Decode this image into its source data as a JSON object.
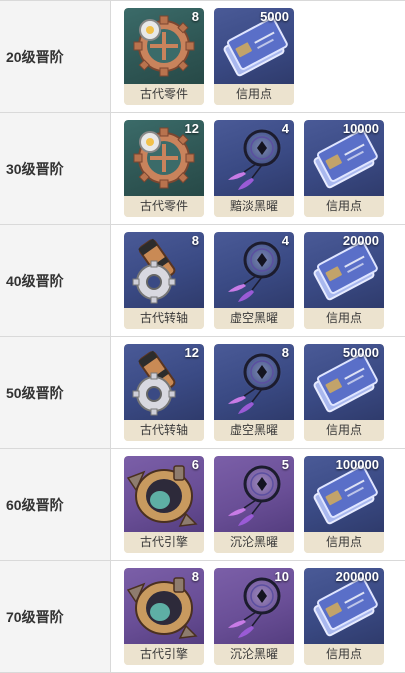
{
  "rows": [
    {
      "label": "20级晋阶",
      "items": [
        {
          "name": "古代零件",
          "count": "8",
          "icon": "gear-icon",
          "bg": "teal"
        },
        {
          "name": "信用点",
          "count": "5000",
          "icon": "credit-card-icon",
          "bg": "blue"
        }
      ]
    },
    {
      "label": "30级晋阶",
      "items": [
        {
          "name": "古代零件",
          "count": "12",
          "icon": "gear-icon",
          "bg": "teal"
        },
        {
          "name": "黯淡黑曜",
          "count": "4",
          "icon": "dreamcatcher-icon",
          "bg": "blue"
        },
        {
          "name": "信用点",
          "count": "10000",
          "icon": "credit-card-icon",
          "bg": "blue"
        }
      ]
    },
    {
      "label": "40级晋阶",
      "items": [
        {
          "name": "古代转轴",
          "count": "8",
          "icon": "spindle-icon",
          "bg": "blue"
        },
        {
          "name": "虚空黑曜",
          "count": "4",
          "icon": "dreamcatcher-icon",
          "bg": "blue"
        },
        {
          "name": "信用点",
          "count": "20000",
          "icon": "credit-card-icon",
          "bg": "blue"
        }
      ]
    },
    {
      "label": "50级晋阶",
      "items": [
        {
          "name": "古代转轴",
          "count": "12",
          "icon": "spindle-icon",
          "bg": "blue"
        },
        {
          "name": "虚空黑曜",
          "count": "8",
          "icon": "dreamcatcher-icon",
          "bg": "blue"
        },
        {
          "name": "信用点",
          "count": "50000",
          "icon": "credit-card-icon",
          "bg": "blue"
        }
      ]
    },
    {
      "label": "60级晋阶",
      "items": [
        {
          "name": "古代引擎",
          "count": "6",
          "icon": "engine-icon",
          "bg": "purple"
        },
        {
          "name": "沉沦黑曜",
          "count": "5",
          "icon": "dreamcatcher-icon",
          "bg": "purple"
        },
        {
          "name": "信用点",
          "count": "100000",
          "icon": "credit-card-icon",
          "bg": "blue"
        }
      ]
    },
    {
      "label": "70级晋阶",
      "items": [
        {
          "name": "古代引擎",
          "count": "8",
          "icon": "engine-icon",
          "bg": "purple"
        },
        {
          "name": "沉沦黑曜",
          "count": "10",
          "icon": "dreamcatcher-icon",
          "bg": "purple"
        },
        {
          "name": "信用点",
          "count": "200000",
          "icon": "credit-card-icon",
          "bg": "blue"
        }
      ]
    }
  ]
}
